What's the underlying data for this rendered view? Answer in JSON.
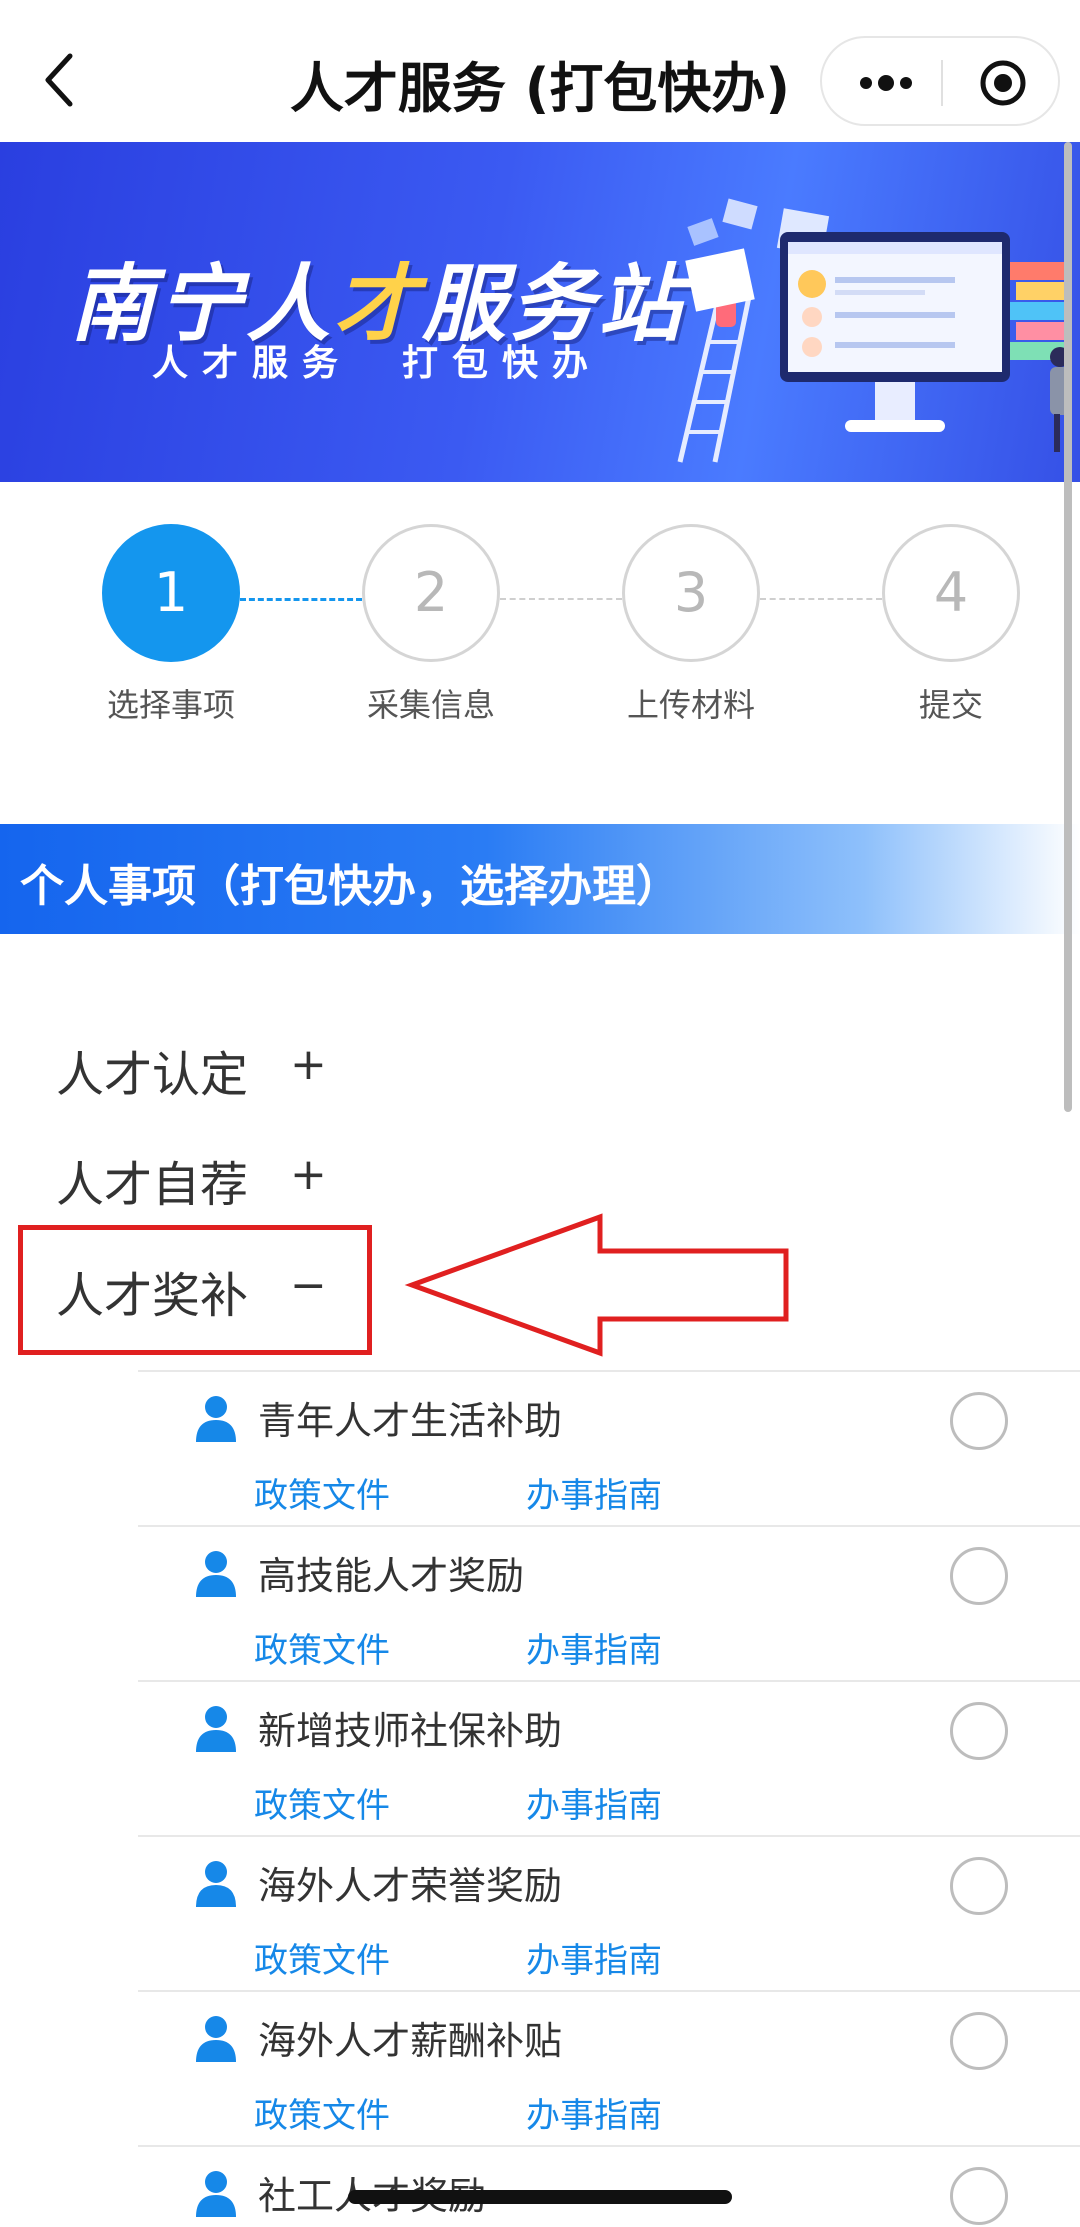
{
  "navbar": {
    "title": "人才服务 (打包快办)",
    "back_icon": "chevron-left-icon",
    "more_icon": "more-dots-icon",
    "close_icon": "target-circle-icon"
  },
  "banner": {
    "title_part1": "南宁人",
    "title_highlight": "才",
    "title_part2": "服务站",
    "subtitle": "人才服务　打包快办"
  },
  "steps": [
    {
      "number": "1",
      "label": "选择事项",
      "active": true
    },
    {
      "number": "2",
      "label": "采集信息",
      "active": false
    },
    {
      "number": "3",
      "label": "上传材料",
      "active": false
    },
    {
      "number": "4",
      "label": "提交",
      "active": false
    }
  ],
  "section": {
    "title": "个人事项（打包快办，选择办理）"
  },
  "categories": [
    {
      "label": "人才认定",
      "sign": "+"
    },
    {
      "label": "人才自荐",
      "sign": "+"
    },
    {
      "label": "人才奖补",
      "sign": "−"
    }
  ],
  "items": [
    {
      "name": "青年人才生活补助",
      "link1": "政策文件",
      "link2": "办事指南"
    },
    {
      "name": "高技能人才奖励",
      "link1": "政策文件",
      "link2": "办事指南"
    },
    {
      "name": "新增技师社保补助",
      "link1": "政策文件",
      "link2": "办事指南"
    },
    {
      "name": "海外人才荣誉奖励",
      "link1": "政策文件",
      "link2": "办事指南"
    },
    {
      "name": "海外人才薪酬补贴",
      "link1": "政策文件",
      "link2": "办事指南"
    },
    {
      "name": "社工人才奖励",
      "link1": "",
      "link2": ""
    }
  ],
  "colors": {
    "accent_blue": "#1496ee",
    "link_blue": "#1688e8",
    "annotation_red": "#e02020"
  }
}
